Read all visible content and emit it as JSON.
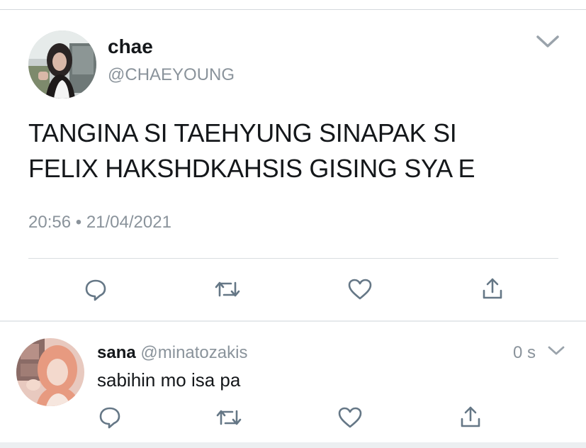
{
  "tweet": {
    "display_name": "chae",
    "handle": "@CHAEYOUNG",
    "text_line1": "TANGINA SI TAEHYUNG SINAPAK SI",
    "text_line2": "FELIX HAKSHDKAHSIS GISING SYA E",
    "time": "20:56",
    "separator": "•",
    "date": "21/04/2021"
  },
  "reply": {
    "display_name": "sana",
    "handle": "@minatozakis",
    "time": "0 s",
    "text": "sabihin mo isa pa"
  },
  "icons": {
    "reply": "comment-bubble-icon",
    "retweet": "retweet-icon",
    "like": "heart-icon",
    "share": "share-upload-icon",
    "menu": "chevron-down-icon"
  },
  "colors": {
    "text": "#14171a",
    "muted": "#8a939b",
    "icon": "#657786",
    "divider": "#d9dde1"
  }
}
